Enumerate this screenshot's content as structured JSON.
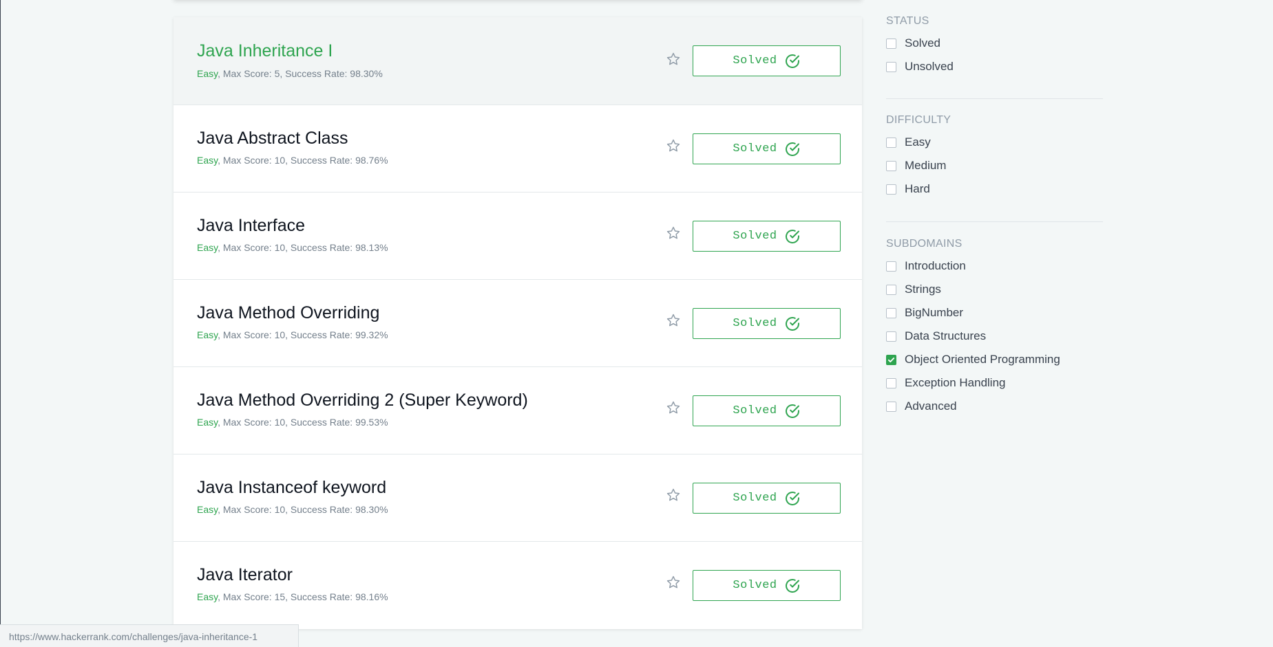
{
  "challenges": [
    {
      "title": "Java Inheritance I",
      "difficulty": "Easy",
      "details": ", Max Score: 5, Success Rate: 98.30%",
      "status": "Solved"
    },
    {
      "title": "Java Abstract Class",
      "difficulty": "Easy",
      "details": ", Max Score: 10, Success Rate: 98.76%",
      "status": "Solved"
    },
    {
      "title": "Java Interface",
      "difficulty": "Easy",
      "details": ", Max Score: 10, Success Rate: 98.13%",
      "status": "Solved"
    },
    {
      "title": "Java Method Overriding",
      "difficulty": "Easy",
      "details": ", Max Score: 10, Success Rate: 99.32%",
      "status": "Solved"
    },
    {
      "title": "Java Method Overriding 2 (Super Keyword)",
      "difficulty": "Easy",
      "details": ", Max Score: 10, Success Rate: 99.53%",
      "status": "Solved"
    },
    {
      "title": "Java Instanceof keyword",
      "difficulty": "Easy",
      "details": ", Max Score: 10, Success Rate: 98.30%",
      "status": "Solved"
    },
    {
      "title": "Java Iterator",
      "difficulty": "Easy",
      "details": ", Max Score: 15, Success Rate: 98.16%",
      "status": "Solved"
    }
  ],
  "filters": {
    "status": {
      "heading": "STATUS",
      "options": [
        {
          "label": "Solved",
          "checked": false
        },
        {
          "label": "Unsolved",
          "checked": false
        }
      ]
    },
    "difficulty": {
      "heading": "DIFFICULTY",
      "options": [
        {
          "label": "Easy",
          "checked": false
        },
        {
          "label": "Medium",
          "checked": false
        },
        {
          "label": "Hard",
          "checked": false
        }
      ]
    },
    "subdomains": {
      "heading": "SUBDOMAINS",
      "options": [
        {
          "label": "Introduction",
          "checked": false
        },
        {
          "label": "Strings",
          "checked": false
        },
        {
          "label": "BigNumber",
          "checked": false
        },
        {
          "label": "Data Structures",
          "checked": false
        },
        {
          "label": "Object Oriented Programming",
          "checked": true
        },
        {
          "label": "Exception Handling",
          "checked": false
        },
        {
          "label": "Advanced",
          "checked": false
        }
      ]
    }
  },
  "status_bar": {
    "url": "https://www.hackerrank.com/challenges/java-inheritance-1"
  },
  "colors": {
    "accent": "#2ea44f",
    "title": "#0e141e",
    "meta": "#737f8b",
    "heading": "#8f9ba7"
  },
  "icons": {
    "star": "star-outline-icon",
    "check": "check-circle-icon"
  }
}
